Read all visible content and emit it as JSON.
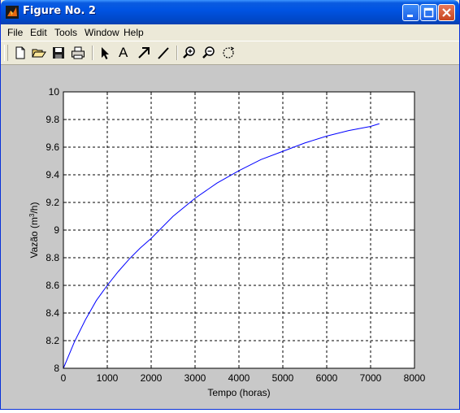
{
  "window": {
    "title": "Figure No. 2",
    "title_color": "#ffffff",
    "titlebar_color": "#0054e3"
  },
  "menu": {
    "items": [
      "File",
      "Edit",
      "Tools",
      "Window",
      "Help"
    ]
  },
  "toolbar": {
    "icons": [
      "new-file-icon",
      "open-folder-icon",
      "save-icon",
      "print-icon",
      "select-arrow-icon",
      "text-icon",
      "arrow-icon",
      "line-icon",
      "zoom-in-icon",
      "zoom-out-icon",
      "rotate-icon"
    ],
    "text_tool_glyph": "A"
  },
  "figure": {
    "background": "#c8c8c8",
    "axes_background": "#ffffff",
    "line_color": "#0000ff"
  },
  "chart_data": {
    "type": "line",
    "title": "",
    "xlabel": "Tempo (horas)",
    "ylabel_prefix": "Vazão (m",
    "ylabel_sup": "3",
    "ylabel_suffix": "/h)",
    "xlim": [
      0,
      8000
    ],
    "ylim": [
      8,
      10
    ],
    "xticks": [
      0,
      1000,
      2000,
      3000,
      4000,
      5000,
      6000,
      7000,
      8000
    ],
    "yticks": [
      8,
      8.2,
      8.4,
      8.6,
      8.8,
      9,
      9.2,
      9.4,
      9.6,
      9.8,
      10
    ],
    "ytick_labels": [
      "8",
      "8.2",
      "8.4",
      "8.6",
      "8.8",
      "9",
      "9.2",
      "9.4",
      "9.6",
      "9.8",
      "10"
    ],
    "grid": true,
    "grid_style": "dashed",
    "series": [
      {
        "x": [
          0,
          250,
          500,
          750,
          1000,
          1250,
          1500,
          1750,
          2000,
          2500,
          3000,
          3500,
          4000,
          4500,
          5000,
          5500,
          6000,
          6500,
          7000,
          7200
        ],
        "y": [
          8.0,
          8.19,
          8.35,
          8.49,
          8.6,
          8.7,
          8.79,
          8.87,
          8.94,
          9.1,
          9.23,
          9.34,
          9.43,
          9.51,
          9.57,
          9.63,
          9.68,
          9.72,
          9.75,
          9.77
        ]
      }
    ]
  }
}
